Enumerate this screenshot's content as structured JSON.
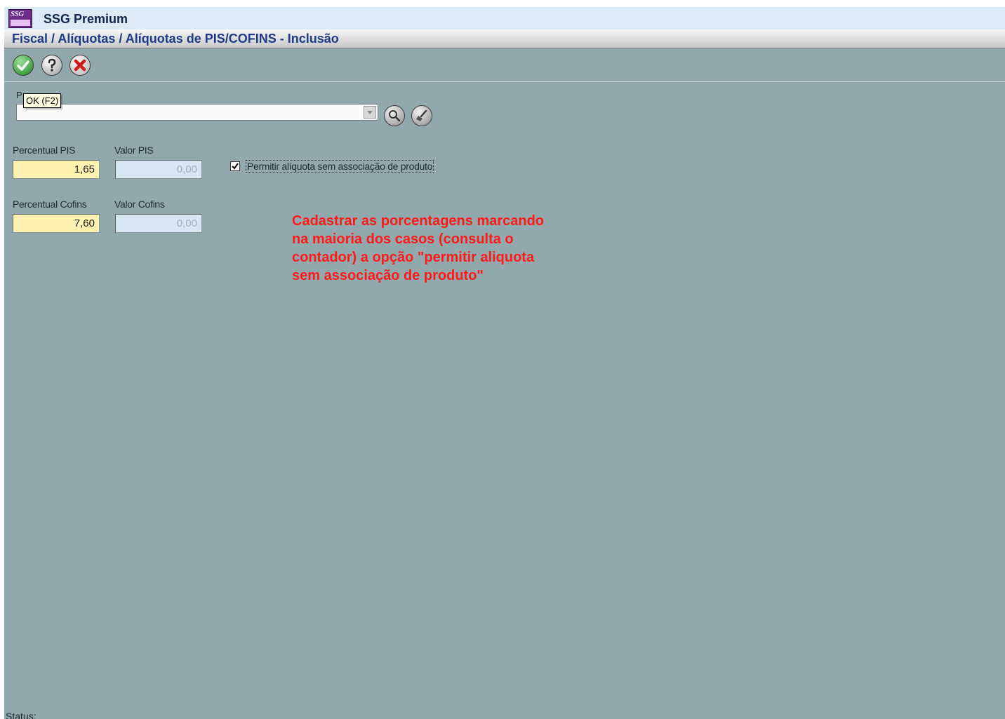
{
  "window": {
    "logo_text": "SSG",
    "title": "SSG Premium"
  },
  "breadcrumb": "Fiscal / Alíquotas / Alíquotas de PIS/COFINS - Inclusão",
  "toolbar": {
    "ok_tooltip": "OK (F2)",
    "icons": [
      "ok-check-icon",
      "help-question-icon",
      "cancel-x-icon"
    ],
    "ok_color": "#1d8a1d",
    "cancel_color": "#d01a1a"
  },
  "form": {
    "produto_label": "P",
    "produto_value": "",
    "percentual_pis": {
      "label": "Percentual PIS",
      "value": "1,65"
    },
    "valor_pis": {
      "label": "Valor PIS",
      "value": "0,00"
    },
    "percentual_cofins": {
      "label": "Percentual Cofins",
      "value": "7,60"
    },
    "valor_cofins": {
      "label": "Valor Cofins",
      "value": "0,00"
    },
    "permitir": {
      "label": "Permitir alíquota sem associação de produto",
      "checked": true
    }
  },
  "annotation": "Cadastrar as porcentagens marcando\nna maioria dos casos (consulta o\ncontador) a opção \"permitir aliquota\nsem associação de produto\"",
  "status_label": "Status:",
  "colors": {
    "background": "#91a8ad",
    "active_field": "#fff2b0",
    "readonly_field": "#d6e6f2",
    "annotation_text": "#ff1a1a"
  }
}
